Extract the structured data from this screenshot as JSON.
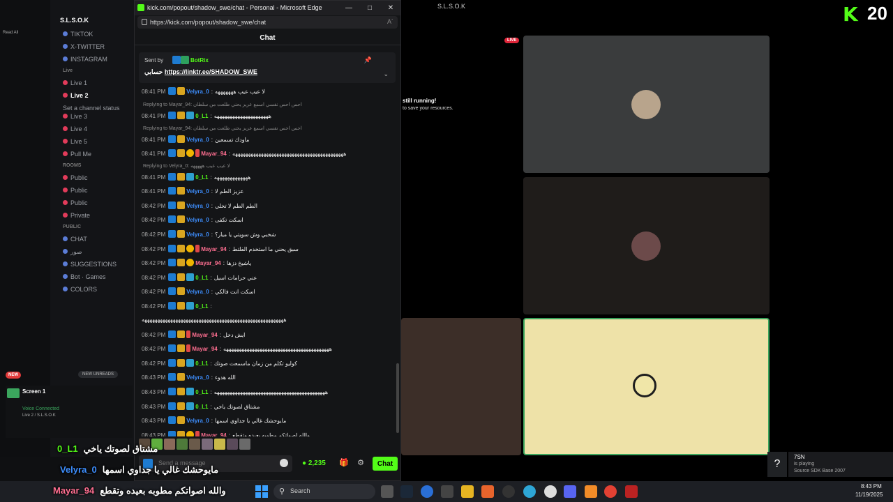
{
  "edge": {
    "title": "kick.com/popout/shadow_swe/chat - Personal - Microsoft Edge",
    "url": "https://kick.com/popout/shadow_swe/chat",
    "address_right": "A´"
  },
  "chat": {
    "header": "Chat",
    "pinned": {
      "sent_by": "Sent by",
      "bot": "BotRix",
      "message_prefix": "حسابي",
      "link": "https://linktr.ee/SHADOW_SWE"
    },
    "input_placeholder": "Send a message",
    "points": "2,235",
    "chat_button": "Chat"
  },
  "messages": [
    {
      "time": "08:41 PM",
      "user": "Velyra_0",
      "color": "#3e8fff",
      "text": "لا عيب عيب هههههههه",
      "badges": [
        "vip",
        "og"
      ]
    },
    {
      "reply": "Replying to Mayar_94: احس احس نفسي اسمع عزيز يحني طلعت من سلطان"
    },
    {
      "time": "08:41 PM",
      "user": "0_L1",
      "color": "#53fc18",
      "text": "هههههههههههههههههههههه",
      "badges": [
        "vip",
        "og",
        "sub"
      ]
    },
    {
      "reply": "Replying to Mayar_94: احس احس نفسي اسمع عزيز يحني طلعت من سلطان"
    },
    {
      "time": "08:41 PM",
      "user": "Velyra_0",
      "color": "#3e8fff",
      "text": "ماودك تسمعين",
      "badges": [
        "vip",
        "og"
      ]
    },
    {
      "time": "08:41 PM",
      "user": "Mayar_94",
      "color": "#ff6f91",
      "text": "هههههههههههههههههههههههههههههههههههههههههههه",
      "badges": [
        "vip",
        "og",
        "lvl",
        "gift"
      ]
    },
    {
      "reply": "Replying to Velyra_0: لا عيب عيب هههههه"
    },
    {
      "time": "08:41 PM",
      "user": "0_L1",
      "color": "#53fc18",
      "text": "هههههههههههههه",
      "badges": [
        "vip",
        "og",
        "sub"
      ]
    },
    {
      "time": "08:41 PM",
      "user": "Velyra_0",
      "color": "#3e8fff",
      "text": "عزيز الطم لا",
      "badges": [
        "vip",
        "og"
      ]
    },
    {
      "time": "08:42 PM",
      "user": "Velyra_0",
      "color": "#3e8fff",
      "text": "الطم الطم لا تخلي",
      "badges": [
        "vip",
        "og"
      ]
    },
    {
      "time": "08:42 PM",
      "user": "Velyra_0",
      "color": "#3e8fff",
      "text": "اسكت تكفى",
      "badges": [
        "vip",
        "og"
      ]
    },
    {
      "time": "08:42 PM",
      "user": "Velyra_0",
      "color": "#3e8fff",
      "text": "شخبي وش سويتي يا ميار؟",
      "badges": [
        "vip",
        "og"
      ]
    },
    {
      "time": "08:42 PM",
      "user": "Mayar_94",
      "color": "#ff6f91",
      "text": "سبق يحني ما استخدم الفلتط",
      "badges": [
        "vip",
        "og",
        "lvl",
        "gift"
      ]
    },
    {
      "time": "08:42 PM",
      "user": "Mayar_94",
      "color": "#ff6f91",
      "text": "ياشيخ دزها",
      "badges": [
        "vip",
        "og",
        "lvl"
      ]
    },
    {
      "time": "08:42 PM",
      "user": "0_L1",
      "color": "#53fc18",
      "text": "عني حرامات اسيل",
      "badges": [
        "vip",
        "og",
        "sub"
      ]
    },
    {
      "time": "08:42 PM",
      "user": "Velyra_0",
      "color": "#3e8fff",
      "text": "اسكت انت فالكي",
      "badges": [
        "vip",
        "og"
      ]
    },
    {
      "time": "08:42 PM",
      "user": "0_L1",
      "color": "#53fc18",
      "text": "",
      "badges": [
        "vip",
        "og",
        "sub"
      ]
    },
    {
      "cont": "هههههههههههههههههههههههههههههههههههههههههههههههههههههههه"
    },
    {
      "time": "08:42 PM",
      "user": "Mayar_94",
      "color": "#ff6f91",
      "text": "ايش دخل",
      "badges": [
        "vip",
        "og",
        "gift"
      ]
    },
    {
      "time": "08:42 PM",
      "user": "Mayar_94",
      "color": "#ff6f91",
      "text": "هههههههههههههههههههههههههههههههههههههههههه",
      "badges": [
        "vip",
        "og",
        "gift"
      ]
    },
    {
      "time": "08:42 PM",
      "user": "0_L1",
      "color": "#53fc18",
      "text": "كوليو تكلم من زمان ماسمعت صوتك",
      "badges": [
        "vip",
        "og",
        "sub"
      ]
    },
    {
      "time": "08:43 PM",
      "user": "Velyra_0",
      "color": "#3e8fff",
      "text": "الله هدوء",
      "badges": [
        "vip",
        "og"
      ]
    },
    {
      "time": "08:43 PM",
      "user": "0_L1",
      "color": "#53fc18",
      "text": "هههههههههههههههههههههههههههههههههههههههههههه",
      "badges": [
        "vip",
        "og",
        "sub"
      ]
    },
    {
      "time": "08:43 PM",
      "user": "0_L1",
      "color": "#53fc18",
      "text": "مشتاق لصوتك ياخي",
      "badges": [
        "vip",
        "og",
        "sub"
      ]
    },
    {
      "time": "08:43 PM",
      "user": "Velyra_0",
      "color": "#3e8fff",
      "text": "مايوحشك غالي يا جداوي اسمها",
      "badges": [
        "vip",
        "og"
      ]
    },
    {
      "time": "08:43 PM",
      "user": "Mayar_94",
      "color": "#ff6f91",
      "text": "والله اصواتكم مطوبه بعيده وتقطع",
      "badges": [
        "vip",
        "og",
        "lvl",
        "gift"
      ]
    }
  ],
  "discord": {
    "server_name": "S.L.S.O.K",
    "read_all": "Read All",
    "channels": [
      {
        "label": "TIKTOK",
        "type": "text"
      },
      {
        "label": "X-TWITTER",
        "type": "text"
      },
      {
        "label": "INSTAGRAM",
        "type": "text"
      },
      {
        "label": "Live",
        "type": "cat"
      },
      {
        "label": "Live 1",
        "type": "voice"
      },
      {
        "label": "Live 2",
        "type": "voice-active"
      },
      {
        "label": "Set a channel status",
        "type": "sub"
      },
      {
        "label": "Live 3",
        "type": "voice"
      },
      {
        "label": "Live 4",
        "type": "voice"
      },
      {
        "label": "Live 5",
        "type": "voice"
      },
      {
        "label": "Pull Me",
        "type": "voice"
      },
      {
        "label": "ROOMS",
        "type": "cat"
      },
      {
        "label": "Public",
        "type": "voice"
      },
      {
        "label": "Public",
        "type": "voice"
      },
      {
        "label": "Public",
        "type": "voice"
      },
      {
        "label": "Private",
        "type": "voice"
      },
      {
        "label": "PUBLIC",
        "type": "cat"
      },
      {
        "label": "CHAT",
        "type": "text"
      },
      {
        "label": "صور",
        "type": "text"
      },
      {
        "label": "SUGGESTIONS",
        "type": "text"
      },
      {
        "label": "Bot · Games",
        "type": "text"
      },
      {
        "label": "COLORS",
        "type": "text"
      }
    ],
    "new_badge": "NEW",
    "new_unreads": "NEW UNREADS",
    "screen": "Screen 1",
    "voice_connected": "Voice Connected",
    "voice_sub": "Live 2 / S.L.S.O.K",
    "stage_title": "S.L.S.O.K",
    "live": "LIVE",
    "still_running": "still running!",
    "save_resources": "to save your resources.",
    "now_playing_user": "7SN",
    "now_playing_1": "is playing",
    "now_playing_2": "Source SDK Base 2007",
    "help": "?"
  },
  "overlay": {
    "line1_user": "0_L1",
    "line1_text": "مشتاق لصوتك ياخي",
    "line2_user": "Velyra_0",
    "line2_text": "مايوحشك غالي يا جداوي اسمها",
    "line3_user": "Mayar_94",
    "line3_text": "والله اصواتكم مطوبه بعيده وتقطع"
  },
  "kick_corner": {
    "logo": "K",
    "number": "20"
  },
  "taskbar": {
    "search": "Search",
    "time": "8:43 PM",
    "date": "11/19/2025"
  },
  "colors": {
    "kick_green": "#53fc18",
    "live_red": "#e0263a",
    "highlight_tile": "#eee2a8"
  }
}
